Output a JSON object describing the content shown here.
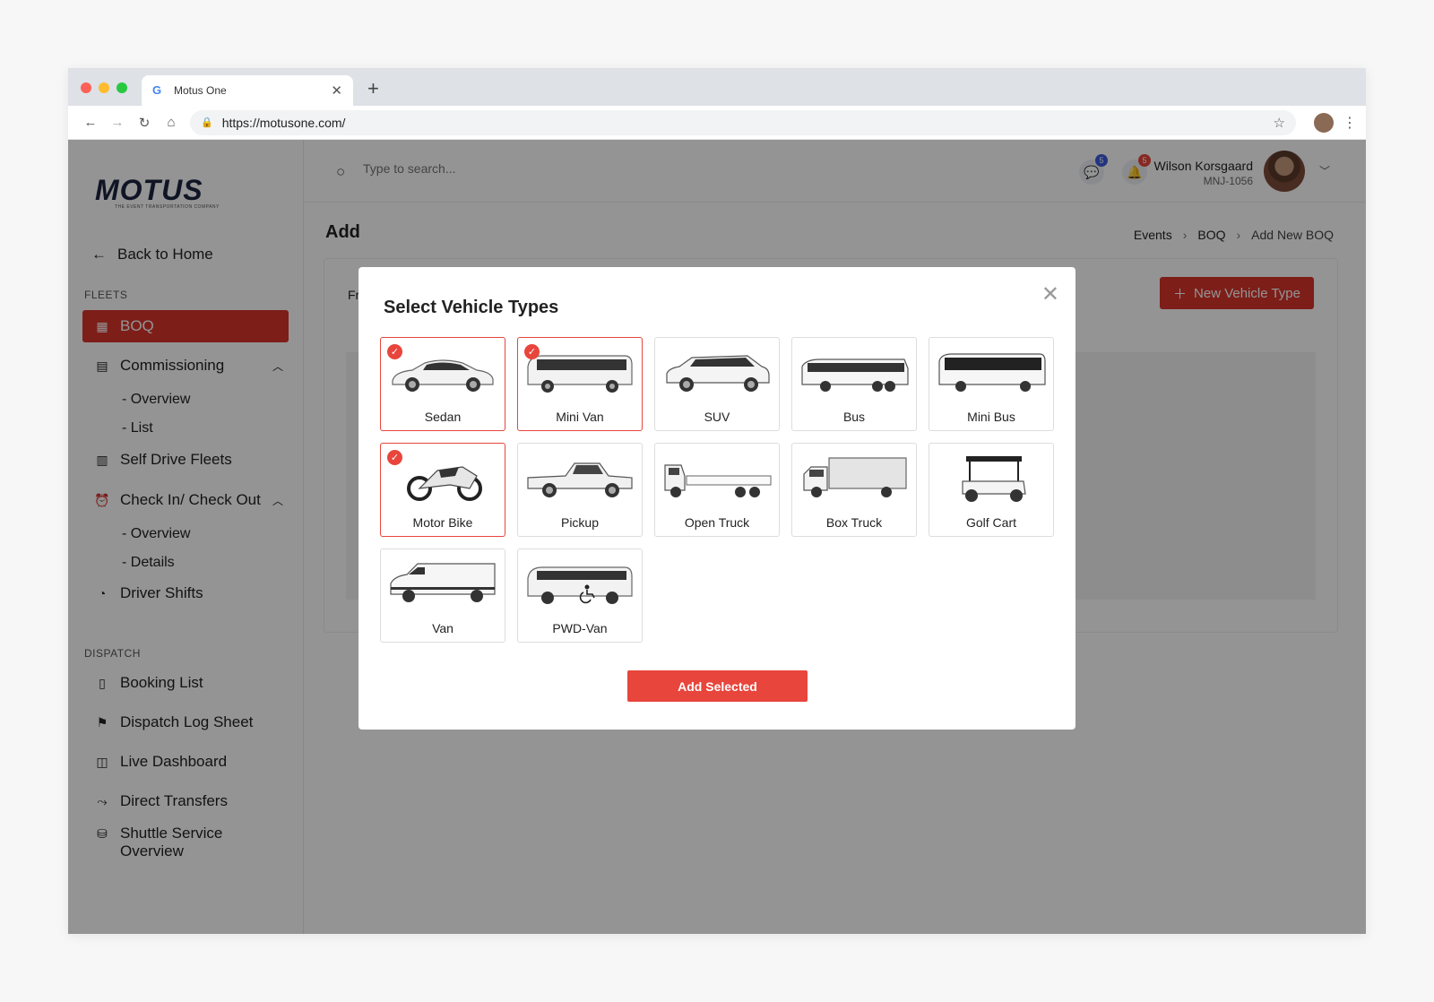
{
  "browser": {
    "tab_title": "Motus One",
    "url": "https://motusone.com/"
  },
  "sidebar": {
    "logo": "MOTUS",
    "logo_tagline": "THE EVENT TRANSPORTATION COMPANY",
    "back_label": "Back to Home",
    "fleets_label": "FLEETS",
    "dispatch_label": "DISPATCH",
    "items": {
      "boq": "BOQ",
      "commissioning": "Commissioning",
      "commissioning_overview": "- Overview",
      "commissioning_list": "- List",
      "self_drive": "Self Drive Fleets",
      "checkin": "Check In/ Check Out",
      "checkin_overview": "- Overview",
      "checkin_details": "- Details",
      "driver_shifts": "Driver Shifts",
      "booking_list": "Booking List",
      "dispatch_log": "Dispatch Log Sheet",
      "live_dashboard": "Live Dashboard",
      "direct_transfers": "Direct Transfers",
      "shuttle_1": "Shuttle Service",
      "shuttle_2": "Overview"
    }
  },
  "header": {
    "search_placeholder": "Type to search...",
    "messages_count": "5",
    "notifications_count": "5",
    "user_name": "Wilson Korsgaard",
    "user_code": "MNJ-1056"
  },
  "page": {
    "title": "Add",
    "card_label": "Fr",
    "new_vehicle_btn": "New Vehicle Type",
    "breadcrumbs": [
      "Events",
      "BOQ",
      "Add New BOQ"
    ]
  },
  "modal": {
    "title": "Select Vehicle Types",
    "add_button": "Add Selected",
    "vehicles": [
      {
        "label": "Sedan",
        "selected": true,
        "icon": "sedan-icon"
      },
      {
        "label": "Mini Van",
        "selected": true,
        "icon": "minivan-icon"
      },
      {
        "label": "SUV",
        "selected": false,
        "icon": "suv-icon"
      },
      {
        "label": "Bus",
        "selected": false,
        "icon": "bus-icon"
      },
      {
        "label": "Mini Bus",
        "selected": false,
        "icon": "minibus-icon"
      },
      {
        "label": "Motor Bike",
        "selected": true,
        "icon": "motorbike-icon"
      },
      {
        "label": "Pickup",
        "selected": false,
        "icon": "pickup-icon"
      },
      {
        "label": "Open Truck",
        "selected": false,
        "icon": "open-truck-icon"
      },
      {
        "label": "Box Truck",
        "selected": false,
        "icon": "box-truck-icon"
      },
      {
        "label": "Golf Cart",
        "selected": false,
        "icon": "golf-cart-icon"
      },
      {
        "label": "Van",
        "selected": false,
        "icon": "van-icon"
      },
      {
        "label": "PWD-Van",
        "selected": false,
        "icon": "pwd-van-icon"
      }
    ]
  },
  "colors": {
    "accent": "#d7352b",
    "modal_accent": "#e8453c",
    "message_badge": "#3b5bdb",
    "notification_badge": "#e8453c"
  }
}
